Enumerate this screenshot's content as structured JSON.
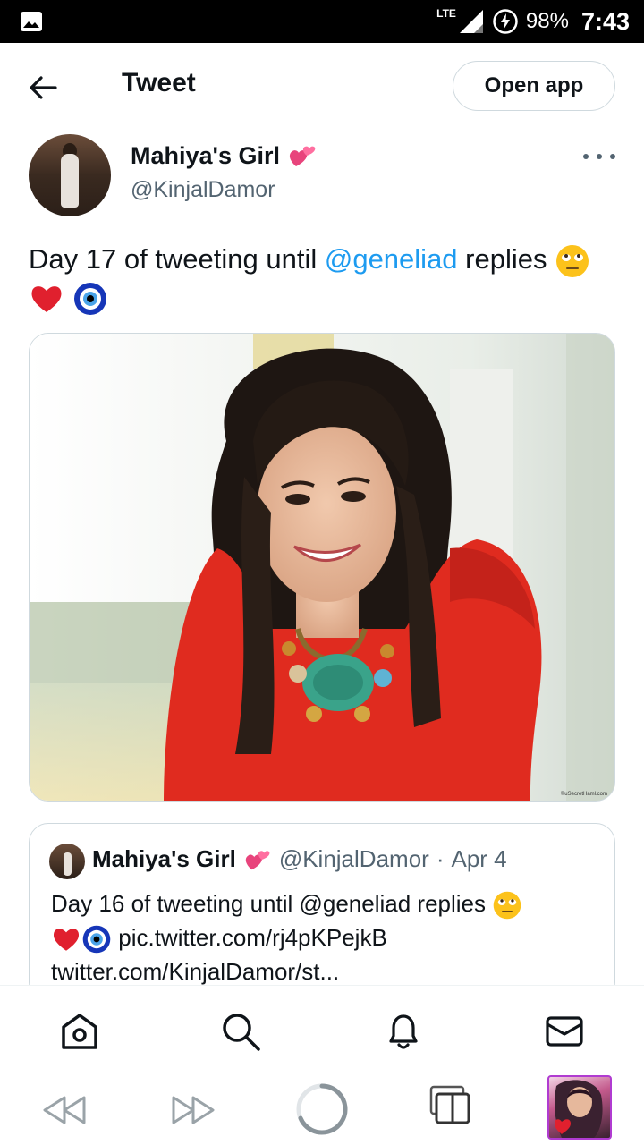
{
  "status_bar": {
    "network": "LTE",
    "battery": "98%",
    "time": "7:43"
  },
  "header": {
    "title": "Tweet",
    "open_app_label": "Open app"
  },
  "tweet": {
    "author_name": "Mahiya's Girl",
    "author_handle": "@KinjalDamor",
    "text_before_mention": "Day 17 of tweeting until ",
    "mention": "@geneliad",
    "text_after_mention": " replies"
  },
  "quote_tweet": {
    "author_name": "Mahiya's Girl",
    "author_handle": "@KinjalDamor",
    "separator": "·",
    "date": "Apr 4",
    "text_line1": "Day 16 of tweeting until @geneliad replies",
    "link1": "pic.twitter.com/rj4pKPejkB",
    "link2": "twitter.com/KinjalDamor/st..."
  },
  "media": {
    "watermark": "©uSecretHaml.com"
  },
  "icons": {
    "status_image": "image-icon",
    "signal": "signal-icon",
    "battery": "battery-charging-icon",
    "back": "arrow-left-icon",
    "verified_emoji": "two-hearts-emoji",
    "eyeroll": "face-rolling-eyes-emoji",
    "heart": "red-heart-emoji",
    "nazar": "nazar-amulet-emoji",
    "nav": [
      "home-icon",
      "search-icon",
      "bell-icon",
      "mail-icon"
    ],
    "browser": [
      "rewind-icon",
      "forward-icon",
      "loading-icon",
      "tabs-icon"
    ]
  },
  "colors": {
    "link": "#1d9bf0",
    "secondary_text": "#536471",
    "border": "#cfd9de"
  }
}
